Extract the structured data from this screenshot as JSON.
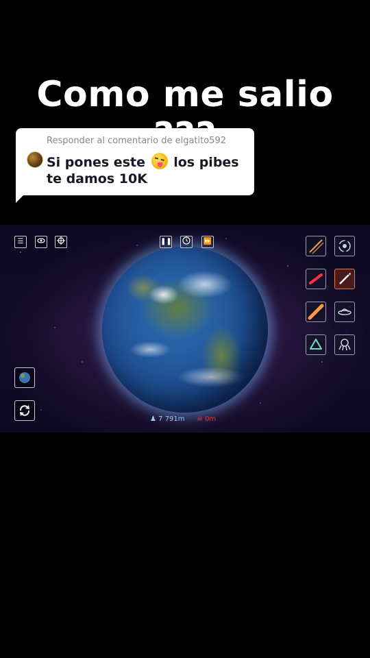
{
  "caption": {
    "title": "Como me salio ???"
  },
  "comment_reply": {
    "header": "Responder al comentario de elgatito592",
    "text_before_emoji": "Si pones este",
    "emoji": "squinting-face-with-tongue",
    "text_after_emoji": "los pibes te damos 10K"
  },
  "game": {
    "top_left_icons": [
      "menu-icon",
      "eye-icon",
      "crosshair-icon"
    ],
    "time_controls": [
      "pause-icon",
      "clock-icon",
      "fast-forward-icon"
    ],
    "weapons": [
      "missiles-icon",
      "black-hole-icon",
      "laser-icon",
      "rocket-icon",
      "meteor-icon",
      "ufo-icon",
      "shield-icon",
      "alien-icon"
    ],
    "selected_weapon": "rocket-icon",
    "population": "7 791m",
    "deaths": "0m"
  },
  "colors": {
    "accent_orange": "#e07a40",
    "population": "#9bc7ff",
    "deaths": "#d93b3b"
  }
}
